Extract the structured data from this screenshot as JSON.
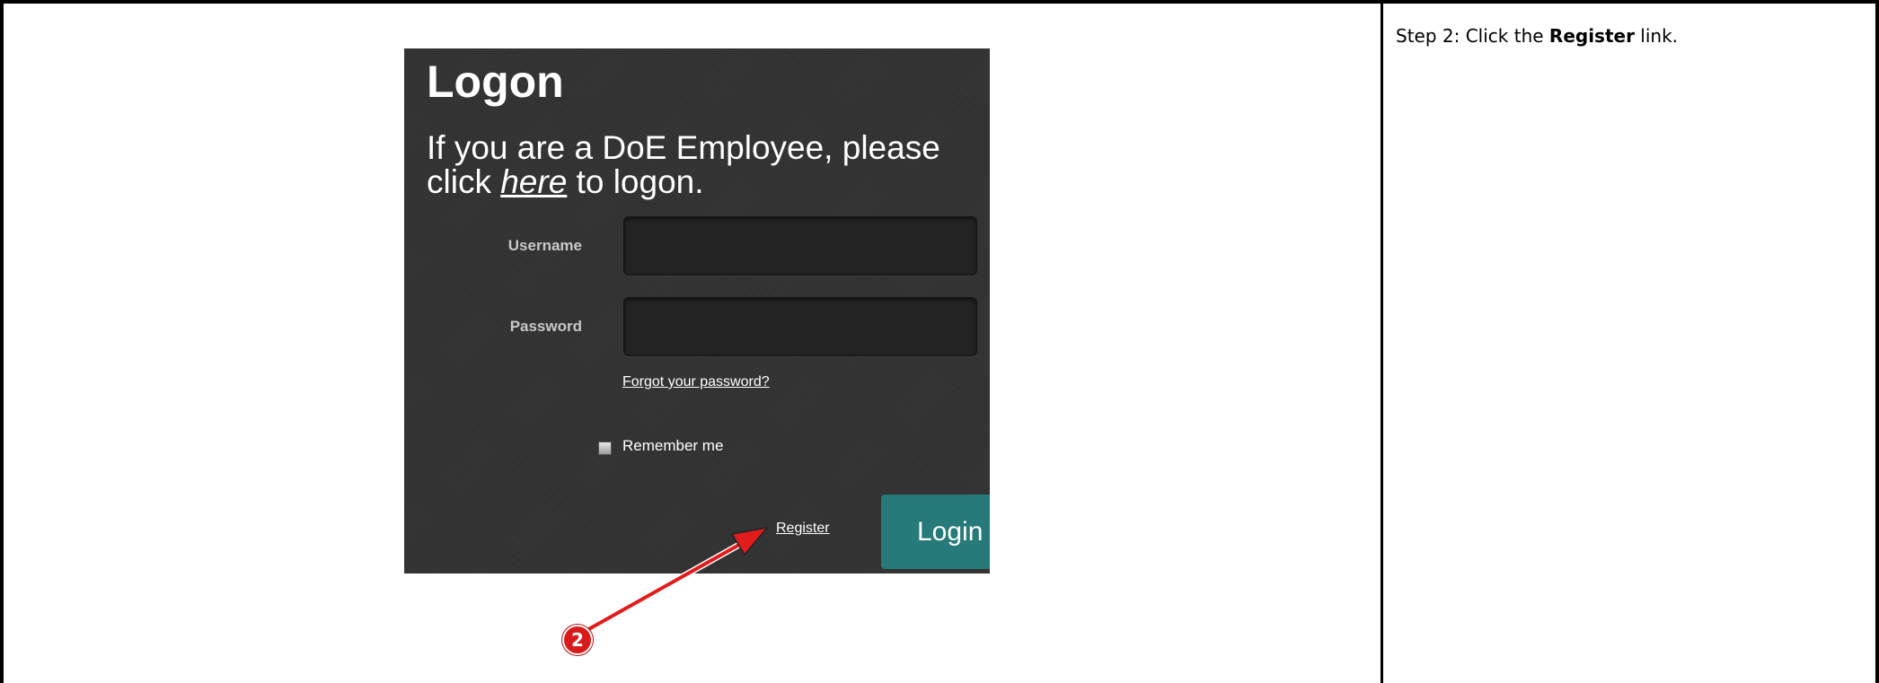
{
  "instruction": {
    "prefix": "Step 2: Click the ",
    "highlight": "Register",
    "suffix": " link."
  },
  "login_panel": {
    "title": "Logon",
    "message_before": "If you are a DoE Employee, please click ",
    "here_link": "here",
    "message_after": " to logon.",
    "username_label": "Username",
    "password_label": "Password",
    "username_value": "",
    "password_value": "",
    "forgot_password_link": "Forgot your password?",
    "remember_me_label": "Remember me",
    "remember_me_checked": false,
    "register_link": "Register",
    "login_button": "Login",
    "accent_color": "#267a79",
    "background_color": "#333333"
  },
  "annotation": {
    "step_number": "2",
    "color": "#d91a1a"
  }
}
